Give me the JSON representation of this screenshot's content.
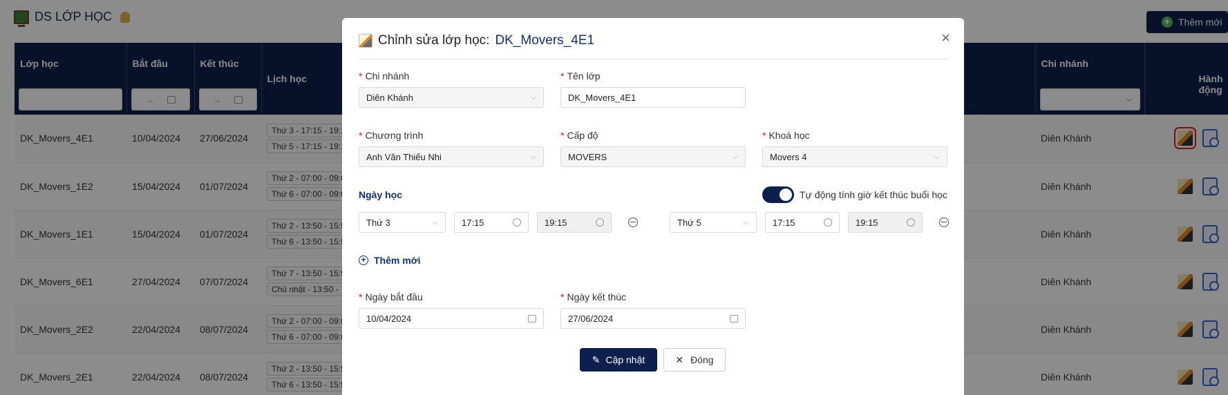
{
  "page": {
    "title": "DS LỚP HỌC",
    "add_button": "Thêm mới"
  },
  "table": {
    "headers": {
      "class": "Lớp học",
      "start": "Bắt đầu",
      "end": "Kết thúc",
      "schedule": "Lịch học",
      "branch": "Chi nhánh",
      "actions": "Hành động"
    },
    "date_range_arrow": "→",
    "rows": [
      {
        "name": "DK_Movers_4E1",
        "start": "10/04/2024",
        "end": "27/06/2024",
        "s1": "Thứ 3 - 17:15 - 19:1",
        "s2": "Thứ 5 - 17:15 - 19:1",
        "branch": "Diên Khánh"
      },
      {
        "name": "DK_Movers_1E2",
        "start": "15/04/2024",
        "end": "01/07/2024",
        "s1": "Thứ 2 - 07:00 - 09:0",
        "s2": "Thứ 6 - 07:00 - 09:0",
        "branch": "Diên Khánh"
      },
      {
        "name": "DK_Movers_1E1",
        "start": "15/04/2024",
        "end": "01/07/2024",
        "s1": "Thứ 2 - 13:50 - 15:5",
        "s2": "Thứ 6 - 13:50 - 15:5",
        "branch": "Diên Khánh"
      },
      {
        "name": "DK_Movers_6E1",
        "start": "27/04/2024",
        "end": "07/07/2024",
        "s1": "Thứ 7 - 13:50 - 15:5",
        "s2": "Chủ nhật - 13:50 -",
        "branch": "Diên Khánh"
      },
      {
        "name": "DK_Movers_2E2",
        "start": "22/04/2024",
        "end": "08/07/2024",
        "s1": "Thứ 2 - 07:00 - 09:0",
        "s2": "Thứ 6 - 07:00 - 09:0",
        "branch": "Diên Khánh"
      },
      {
        "name": "DK_Movers_2E1",
        "start": "22/04/2024",
        "end": "08/07/2024",
        "s1": "Thứ 2 - 13:50 - 15:5",
        "s2": "Thứ 6 - 13:50 - 15:5",
        "branch": "Diên Khánh"
      }
    ]
  },
  "modal": {
    "title": "Chỉnh sửa lớp học:",
    "class_name": "DK_Movers_4E1",
    "close": "×",
    "branch_label": "Chi nhánh",
    "branch_value": "Diên Khánh",
    "name_label": "Tên lớp",
    "name_value": "DK_Movers_4E1",
    "program_label": "Chương trình",
    "program_value": "Anh Văn Thiếu Nhi",
    "level_label": "Cấp độ",
    "level_value": "MOVERS",
    "course_label": "Khoá học",
    "course_value": "Movers 4",
    "days_label": "Ngày học",
    "auto_label": "Tự động tính giờ kết thúc buổi học",
    "slot1": {
      "day": "Thứ 3",
      "from": "17:15",
      "to": "19:15"
    },
    "slot2": {
      "day": "Thứ 5",
      "from": "17:15",
      "to": "19:15"
    },
    "add_new": "Thêm mới",
    "start_label": "Ngày bắt đầu",
    "start_value": "10/04/2024",
    "end_label": "Ngày kết thúc",
    "end_value": "27/06/2024",
    "update_btn": "Cập nhật",
    "close_btn": "Đóng",
    "required_mark": "*"
  }
}
